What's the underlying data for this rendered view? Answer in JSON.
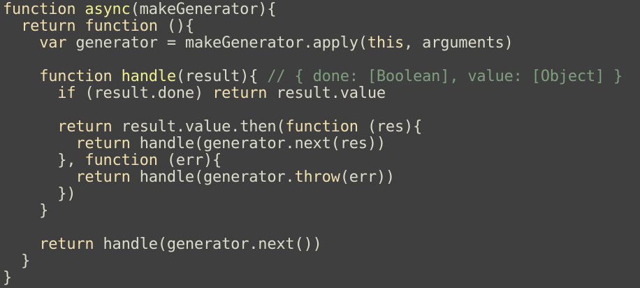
{
  "colors": {
    "background": "#3f3f3f",
    "text": "#dcdccc",
    "keyword": "#f0dfaf",
    "function_name": "#efef8f",
    "comment": "#7f9f7f"
  },
  "code": {
    "lines": [
      [
        {
          "t": "kw",
          "v": "function "
        },
        {
          "t": "fn",
          "v": "async"
        },
        {
          "t": "tx",
          "v": "(makeGenerator){"
        }
      ],
      [
        {
          "t": "tx",
          "v": "  "
        },
        {
          "t": "kw",
          "v": "return"
        },
        {
          "t": "tx",
          "v": " "
        },
        {
          "t": "kw",
          "v": "function"
        },
        {
          "t": "tx",
          "v": " (){"
        }
      ],
      [
        {
          "t": "tx",
          "v": "    "
        },
        {
          "t": "kw",
          "v": "var"
        },
        {
          "t": "tx",
          "v": " generator = makeGenerator.apply("
        },
        {
          "t": "kw",
          "v": "this"
        },
        {
          "t": "tx",
          "v": ", arguments)"
        }
      ],
      [
        {
          "t": "tx",
          "v": ""
        }
      ],
      [
        {
          "t": "tx",
          "v": "    "
        },
        {
          "t": "kw",
          "v": "function"
        },
        {
          "t": "tx",
          "v": " "
        },
        {
          "t": "fn",
          "v": "handle"
        },
        {
          "t": "tx",
          "v": "(result){ "
        },
        {
          "t": "cm",
          "v": "// { done: [Boolean], value: [Object] }"
        }
      ],
      [
        {
          "t": "tx",
          "v": "      "
        },
        {
          "t": "kw",
          "v": "if"
        },
        {
          "t": "tx",
          "v": " (result.done) "
        },
        {
          "t": "kw",
          "v": "return"
        },
        {
          "t": "tx",
          "v": " result.value"
        }
      ],
      [
        {
          "t": "tx",
          "v": ""
        }
      ],
      [
        {
          "t": "tx",
          "v": "      "
        },
        {
          "t": "kw",
          "v": "return"
        },
        {
          "t": "tx",
          "v": " result.value.then("
        },
        {
          "t": "kw",
          "v": "function"
        },
        {
          "t": "tx",
          "v": " (res){"
        }
      ],
      [
        {
          "t": "tx",
          "v": "        "
        },
        {
          "t": "kw",
          "v": "return"
        },
        {
          "t": "tx",
          "v": " handle(generator.next(res))"
        }
      ],
      [
        {
          "t": "tx",
          "v": "      }, "
        },
        {
          "t": "kw",
          "v": "function"
        },
        {
          "t": "tx",
          "v": " (err){"
        }
      ],
      [
        {
          "t": "tx",
          "v": "        "
        },
        {
          "t": "kw",
          "v": "return"
        },
        {
          "t": "tx",
          "v": " handle(generator."
        },
        {
          "t": "kw",
          "v": "throw"
        },
        {
          "t": "tx",
          "v": "(err))"
        }
      ],
      [
        {
          "t": "tx",
          "v": "      })"
        }
      ],
      [
        {
          "t": "tx",
          "v": "    }"
        }
      ],
      [
        {
          "t": "tx",
          "v": ""
        }
      ],
      [
        {
          "t": "tx",
          "v": "    "
        },
        {
          "t": "kw",
          "v": "return"
        },
        {
          "t": "tx",
          "v": " handle(generator.next())"
        }
      ],
      [
        {
          "t": "tx",
          "v": "  }"
        }
      ],
      [
        {
          "t": "tx",
          "v": "}"
        }
      ]
    ]
  }
}
